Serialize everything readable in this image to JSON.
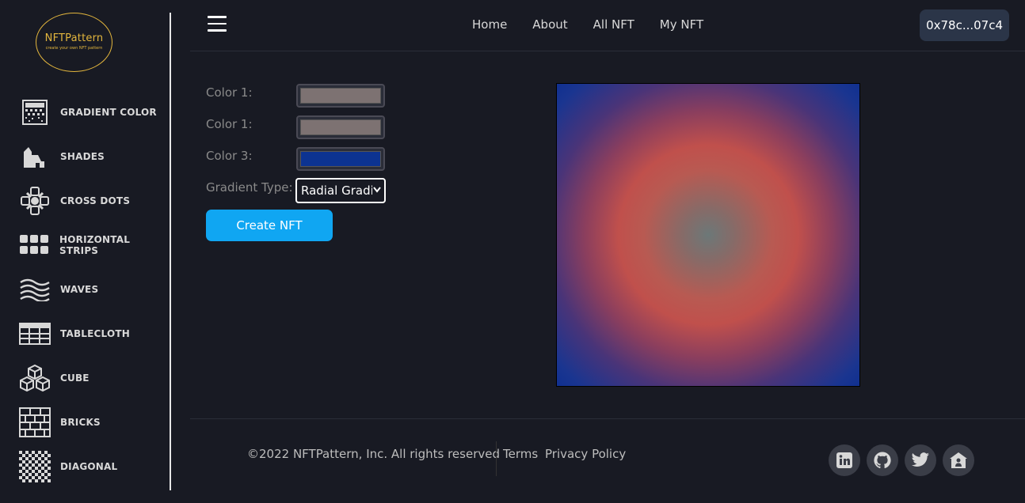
{
  "logo": {
    "title": "NFTPattern",
    "tagline": "create your own NFT pattern"
  },
  "sidebar": {
    "items": [
      {
        "label": "GRADIENT COLOR",
        "icon": "gradient-icon"
      },
      {
        "label": "SHADES",
        "icon": "shades-icon"
      },
      {
        "label": "CROSS DOTS",
        "icon": "cross-dots-icon"
      },
      {
        "label": "HORIZONTAL STRIPS",
        "icon": "horizontal-strips-icon"
      },
      {
        "label": "WAVES",
        "icon": "waves-icon"
      },
      {
        "label": "TABLECLOTH",
        "icon": "tablecloth-icon"
      },
      {
        "label": "CUBE",
        "icon": "cube-icon"
      },
      {
        "label": "BRICKS",
        "icon": "bricks-icon"
      },
      {
        "label": "DIAGONAL",
        "icon": "diagonal-icon"
      }
    ]
  },
  "topnav": {
    "links": [
      "Home",
      "About",
      "All NFT",
      "My NFT"
    ],
    "wallet": "0x78c...07c4"
  },
  "form": {
    "color1_label": "Color 1:",
    "color2_label": "Color 1:",
    "color3_label": "Color 3:",
    "gradient_type_label": "Gradient Type:",
    "color1_value": "#7d7272",
    "color2_value": "#7d7272",
    "color3_value": "#0c3391",
    "gradient_type_value": "Radial Gradient",
    "create_button": "Create NFT"
  },
  "footer": {
    "copyright": "©2022 NFTPattern, Inc. All rights reserved",
    "terms": "Terms",
    "privacy": "Privacy Policy",
    "social": [
      "linkedin-icon",
      "github-icon",
      "twitter-icon",
      "home-icon"
    ]
  },
  "colors": {
    "accent": "#10a6f2",
    "logo": "#e2b53d",
    "wallet_bg": "#2b3548"
  }
}
